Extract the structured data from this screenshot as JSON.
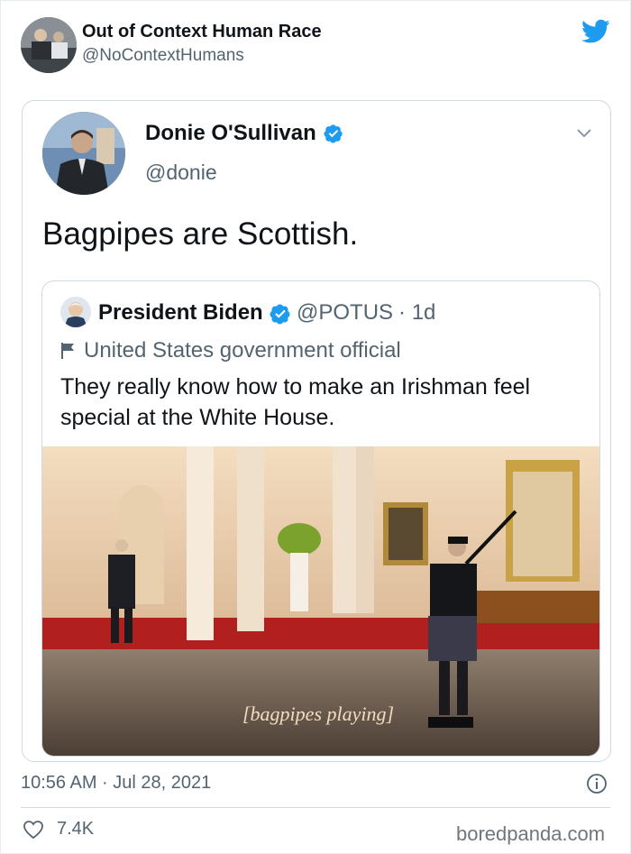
{
  "tweet": {
    "author_name": "Out of Context Human Race",
    "author_handle": "@NoContextHumans",
    "timestamp": "10:56 AM · Jul 28, 2021",
    "likes": "7.4K"
  },
  "quoted": {
    "author_name": "Donie O'Sullivan",
    "author_handle": "@donie",
    "text": "Bagpipes are Scottish."
  },
  "inner_quote": {
    "author_name": "President Biden",
    "author_handle": "@POTUS",
    "time_ago": "· 1d",
    "official_label": "United States government official",
    "text": "They really know how to make an Irishman feel special at the White House.",
    "media_caption": "[bagpipes playing]"
  },
  "watermark": "boredpanda.com",
  "colors": {
    "twitter_blue": "#1d9bf0",
    "secondary_text": "#536471",
    "border": "#cfd9de"
  },
  "icons": {
    "brand": "twitter-bird-icon",
    "verified": "verified-badge-icon",
    "menu": "chevron-down-icon",
    "official": "flag-icon",
    "info": "info-icon",
    "like": "heart-icon"
  }
}
